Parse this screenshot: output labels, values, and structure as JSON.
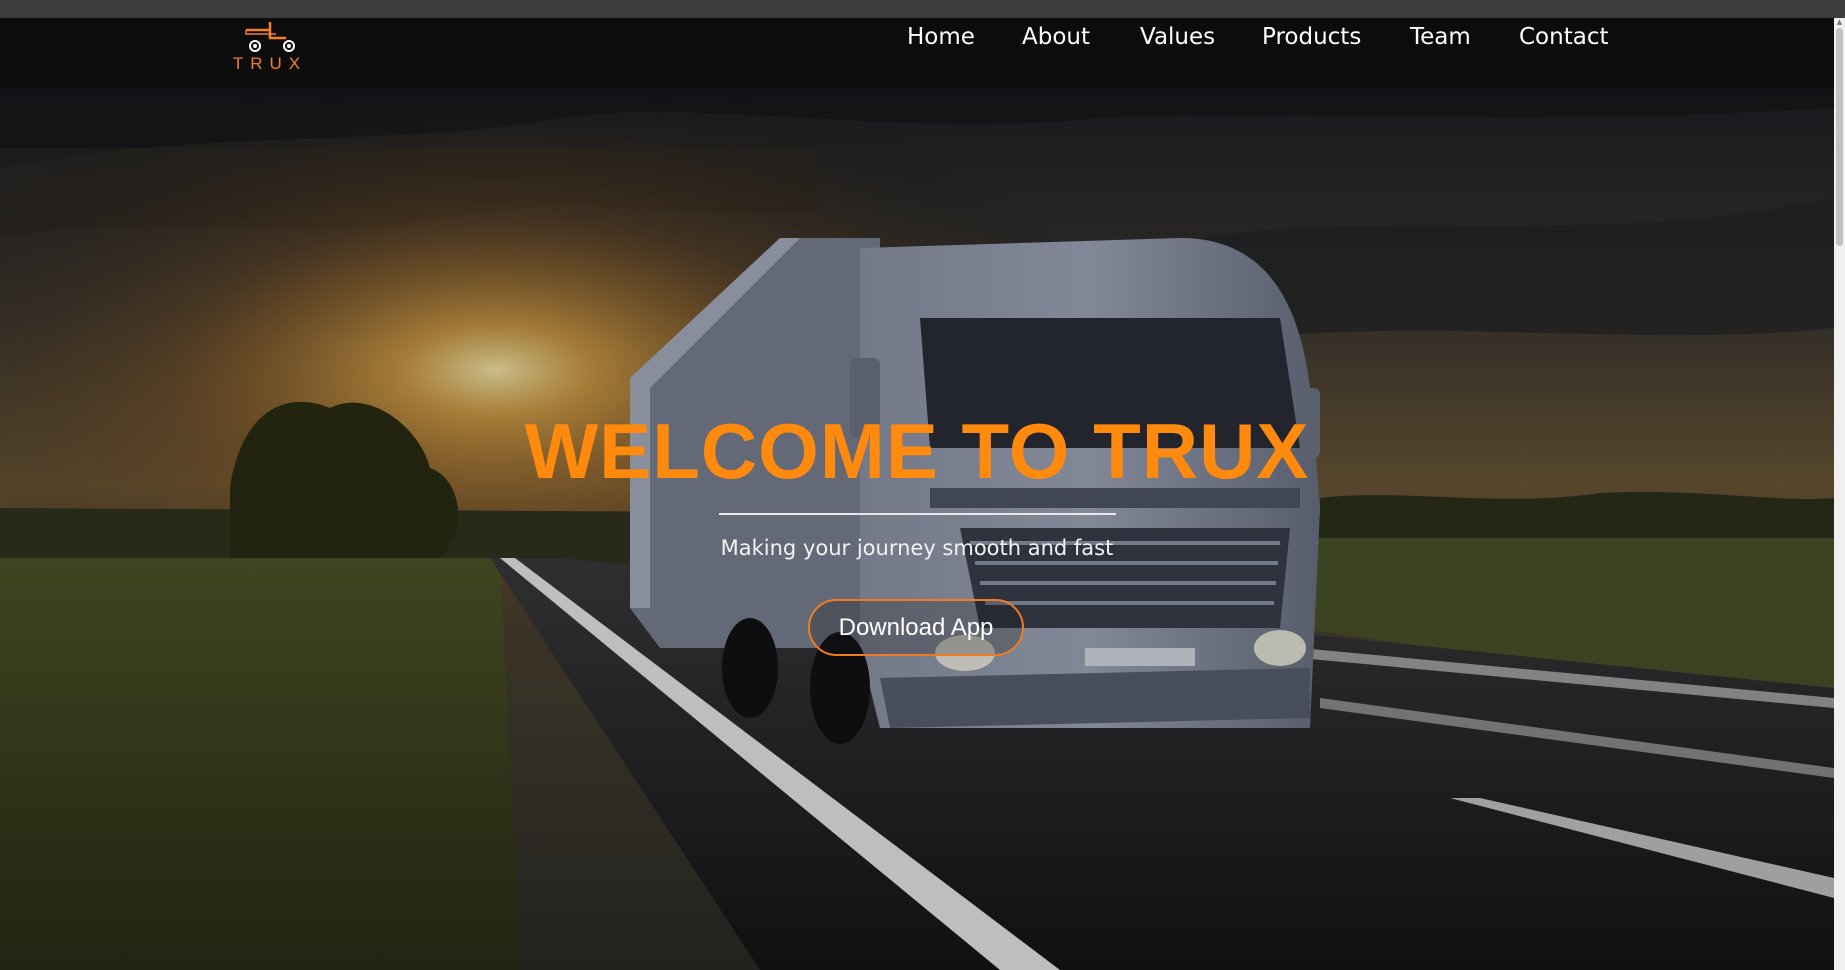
{
  "brand": {
    "name": "TRUX",
    "accent": "#ff8a0d"
  },
  "nav": {
    "items": [
      {
        "label": "Home"
      },
      {
        "label": "About"
      },
      {
        "label": "Values"
      },
      {
        "label": "Products"
      },
      {
        "label": "Team"
      },
      {
        "label": "Contact"
      }
    ]
  },
  "hero": {
    "title": "WELCOME TO TRUX",
    "subtitle": "Making your journey smooth and fast",
    "button_label": "Download App"
  },
  "icons": {
    "logo": "truck-logo-icon",
    "scroll_up": "scroll-up-arrow-icon"
  }
}
